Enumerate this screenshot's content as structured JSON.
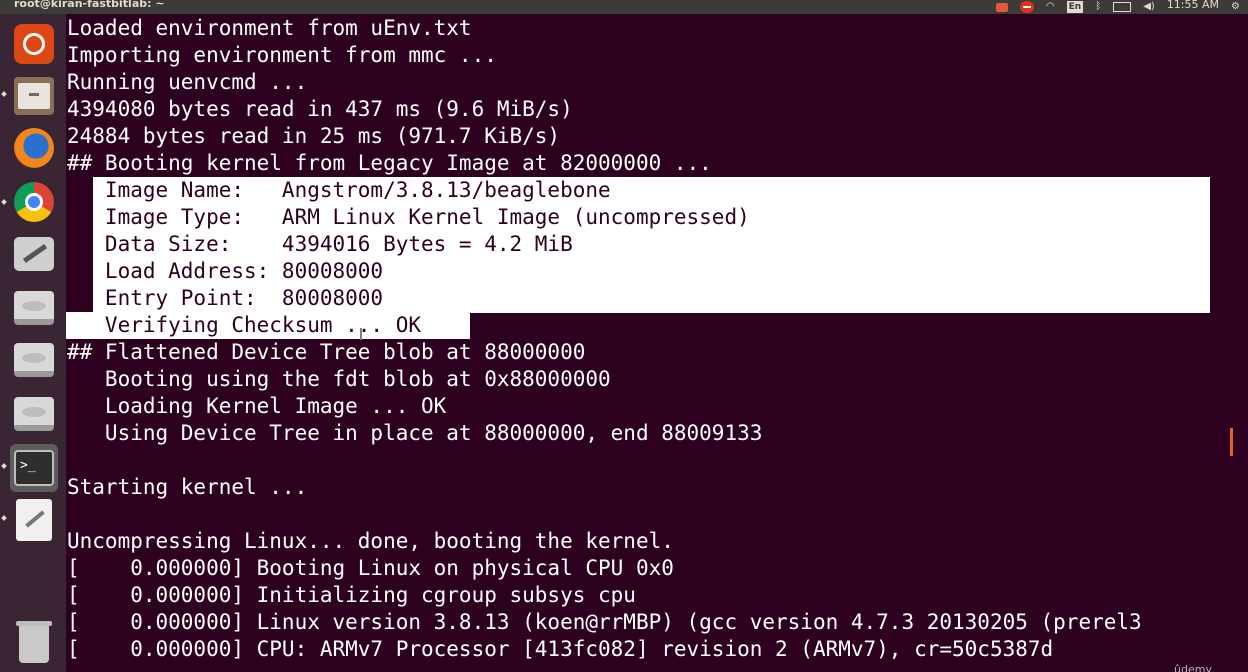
{
  "window": {
    "title": "root@kiran-fastbitlab: ~"
  },
  "panel": {
    "indicators": [
      "record-icon",
      "stop-icon",
      "wifi-icon",
      "keyboard-layout-icon",
      "bluetooth-icon",
      "battery-icon",
      "volume-icon",
      "gear-icon"
    ],
    "keyboard_layout": "En",
    "time": "11:55 AM",
    "wifi_glyph": "◠",
    "bluetooth_glyph": "ᛒ",
    "volume_glyph": "◀)",
    "gear_glyph": "⚙"
  },
  "launcher": {
    "items": [
      "ubuntu-dash-icon",
      "files-icon",
      "firefox-icon",
      "chrome-icon",
      "system-tools-icon",
      "drive-icon",
      "drive-icon",
      "drive-icon",
      "terminal-icon",
      "text-editor-icon",
      "trash-icon"
    ],
    "active": "terminal-icon"
  },
  "terminal": {
    "lines": [
      "Loaded environment from uEnv.txt",
      "Importing environment from mmc ...",
      "Running uenvcmd ...",
      "4394080 bytes read in 437 ms (9.6 MiB/s)",
      "24884 bytes read in 25 ms (971.7 KiB/s)",
      "## Booting kernel from Legacy Image at 82000000 ...",
      "   Image Name:   Angstrom/3.8.13/beaglebone",
      "   Image Type:   ARM Linux Kernel Image (uncompressed)",
      "   Data Size:    4394016 Bytes = 4.2 MiB",
      "   Load Address: 80008000",
      "   Entry Point:  80008000",
      "   Verifying Checksum ... OK",
      "## Flattened Device Tree blob at 88000000",
      "   Booting using the fdt blob at 0x88000000",
      "   Loading Kernel Image ... OK",
      "   Using Device Tree in place at 88000000, end 88009133",
      "",
      "Starting kernel ...",
      "",
      "Uncompressing Linux... done, booting the kernel.",
      "[    0.000000] Booting Linux on physical CPU 0x0",
      "[    0.000000] Initializing cgroup subsys cpu",
      "[    0.000000] Linux version 3.8.13 (koen@rrMBP) (gcc version 4.7.3 20130205 (prerel3",
      "[    0.000000] CPU: ARMv7 Processor [413fc082] revision 2 (ARMv7), cr=50c5387d"
    ]
  },
  "watermark": "ûdemy"
}
